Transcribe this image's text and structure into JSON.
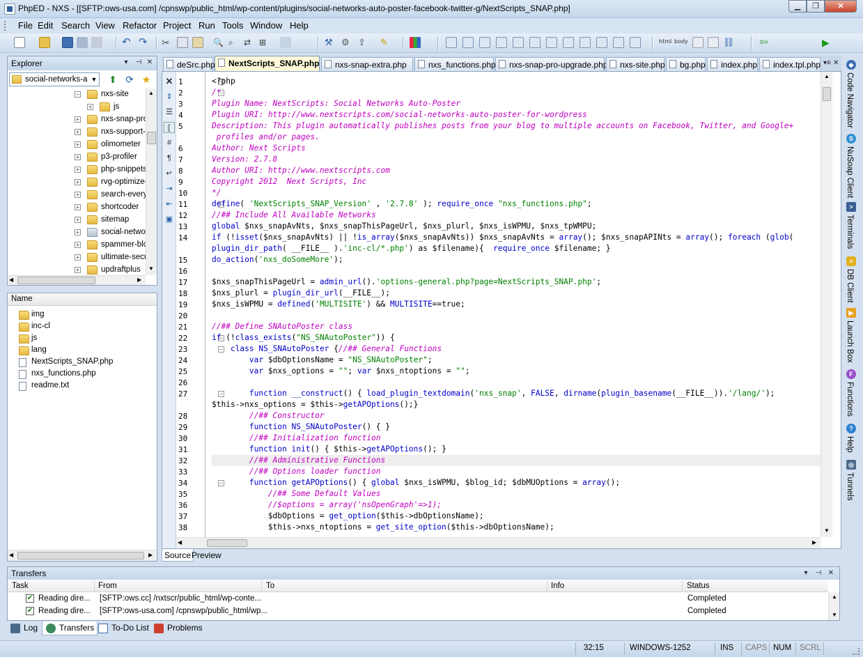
{
  "window": {
    "title": "PhpED - NXS - [[SFTP:ows-usa.com] /cpnswp/public_html/wp-content/plugins/social-networks-auto-poster-facebook-twitter-g/NextScripts_SNAP.php]",
    "minimize_icon": "minimize-icon",
    "maximize_icon": "maximize-icon",
    "close_icon": "close-icon"
  },
  "menu": [
    "File",
    "Edit",
    "Search",
    "View",
    "Refactor",
    "Project",
    "Run",
    "Tools",
    "Window",
    "Help"
  ],
  "toolbar": {
    "html_label": "html",
    "body_label": "body"
  },
  "explorer": {
    "title": "Explorer",
    "root": "social-networks-au",
    "tree": [
      {
        "label": "nxs-site",
        "expanded": true
      },
      {
        "label": "js",
        "child": true
      },
      {
        "label": "nxs-snap-pro"
      },
      {
        "label": "nxs-support-"
      },
      {
        "label": "olimometer"
      },
      {
        "label": "p3-profiler"
      },
      {
        "label": "php-snippets"
      },
      {
        "label": "rvg-optimize-"
      },
      {
        "label": "search-every"
      },
      {
        "label": "shortcoder"
      },
      {
        "label": "sitemap"
      },
      {
        "label": "social-networ",
        "selected": true
      },
      {
        "label": "spammer-blo"
      },
      {
        "label": "ultimate-secu"
      },
      {
        "label": "updraftplus"
      }
    ]
  },
  "filelist": {
    "column": "Name",
    "folders": [
      "img",
      "inc-cl",
      "js",
      "lang"
    ],
    "files": [
      "NextScripts_SNAP.php",
      "nxs_functions.php",
      "readme.txt"
    ]
  },
  "tabs": [
    "deSrc.php",
    "NextScripts_SNAP.php",
    "nxs-snap-extra.php",
    "nxs_functions.php",
    "nxs-snap-pro-upgrade.php",
    "nxs-site.php",
    "bg.php",
    "index.php",
    "index.tpl.php"
  ],
  "editor": {
    "line_numbers": [
      "1",
      "2",
      "3",
      "4",
      "5",
      "",
      "6",
      "7",
      "8",
      "9",
      "10",
      "11",
      "12",
      "13",
      "14",
      "",
      "15",
      "16",
      "17",
      "18",
      "19",
      "20",
      "21",
      "22",
      "23",
      "24",
      "25",
      "26",
      "27",
      "",
      "28",
      "29",
      "30",
      "31",
      "32",
      "33",
      "34",
      "35",
      "36",
      "37",
      "38"
    ],
    "lines": [
      "<?php",
      "/*",
      "Plugin Name: NextScripts: Social Networks Auto-Poster",
      "Plugin URI: http://www.nextscripts.com/social-networks-auto-poster-for-wordpress",
      "Description: This plugin automatically publishes posts from your blog to multiple accounts on Facebook, Twitter, and Google+",
      " profiles and/or pages.",
      "Author: Next Scripts",
      "Version: 2.7.8",
      "Author URI: http://www.nextscripts.com",
      "Copyright 2012  Next Scripts, Inc",
      "*/",
      "define( 'NextScripts_SNAP_Version' , '2.7.8' ); require_once \"nxs_functions.php\";",
      "//## Include All Available Networks",
      "global $nxs_snapAvNts, $nxs_snapThisPageUrl, $nxs_plurl, $nxs_isWPMU, $nxs_tpWMPU;",
      "if (!isset($nxs_snapAvNts) || !is_array($nxs_snapAvNts)) $nxs_snapAvNts = array(); $nxs_snapAPINts = array(); foreach (glob(",
      "plugin_dir_path( __FILE__ ).'inc-cl/*.php') as $filename){  require_once $filename; }",
      "do_action('nxs_doSomeMore');",
      "",
      "$nxs_snapThisPageUrl = admin_url().'options-general.php?page=NextScripts_SNAP.php';",
      "$nxs_plurl = plugin_dir_url(__FILE__);",
      "$nxs_isWPMU = defined('MULTISITE') && MULTISITE==true;",
      "",
      "//## Define SNAutoPoster class",
      "if (!class_exists(\"NS_SNAutoPoster\")) {",
      "    class NS_SNAutoPoster {//## General Functions",
      "        var $dbOptionsName = \"NS_SNAutoPoster\";",
      "        var $nxs_options = \"\"; var $nxs_ntoptions = \"\";",
      "",
      "        function __construct() { load_plugin_textdomain('nxs_snap', FALSE, dirname(plugin_basename(__FILE__)).'/lang/');",
      "$this->nxs_options = $this->getAPOptions();}",
      "        //## Constructor",
      "        function NS_SNAutoPoster() { }",
      "        //## Initialization function",
      "        function init() { $this->getAPOptions(); }",
      "        //## Administrative Functions",
      "        //## Options loader function",
      "        function getAPOptions() { global $nxs_isWPMU, $blog_id; $dbMUOptions = array();",
      "            //## Some Default Values",
      "            //$options = array('nsOpenGraph'=>1);",
      "            $dbOptions = get_option($this->dbOptionsName);",
      "            $this->nxs_ntoptions = get_site_option($this->dbOptionsName);"
    ]
  },
  "source_tab": "Source",
  "preview_tab": "Preview",
  "right_rail": [
    "Code Navigator",
    "NuSoap Client",
    "Terminals",
    "DB Client",
    "Launch Box",
    "Functions",
    "Help",
    "Tunnels"
  ],
  "transfers": {
    "title": "Transfers",
    "columns": [
      "Task",
      "From",
      "To",
      "Info",
      "Status"
    ],
    "rows": [
      {
        "task": "Reading dire...",
        "from": "[SFTP:ows.cc] /nxtscr/public_html/wp-conte...",
        "to": "",
        "info": "",
        "status": "Completed"
      },
      {
        "task": "Reading dire...",
        "from": "[SFTP:ows-usa.com] /cpnswp/public_html/wp...",
        "to": "",
        "info": "",
        "status": "Completed"
      }
    ]
  },
  "bottom_tabs": [
    "Log",
    "Transfers",
    "To-Do List",
    "Problems"
  ],
  "status": {
    "position": "32:15",
    "encoding": "WINDOWS-1252",
    "ins": "INS",
    "caps": "CAPS",
    "num": "NUM",
    "scrl": "SCRL"
  },
  "colors": {
    "comment": "#c000c0",
    "string": "#008000",
    "function": "#0000c8"
  }
}
